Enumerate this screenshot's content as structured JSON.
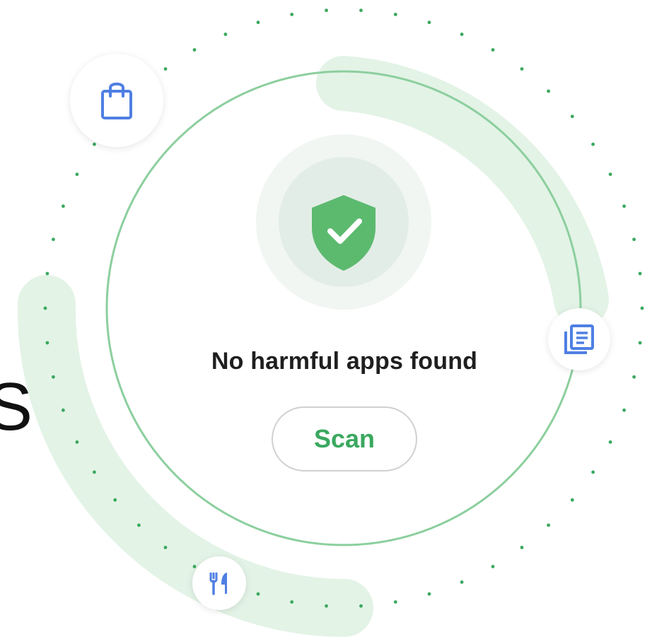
{
  "status": {
    "message": "No harmful apps found"
  },
  "scan_button": {
    "label": "Scan"
  },
  "partial_text": "S",
  "colors": {
    "accent_green": "#34a853",
    "ring_green": "#8ccf9e",
    "track_green": "#e3f3e6",
    "dot_green": "#3aa85f",
    "icon_blue": "#4f7fe3",
    "shield_green": "#5cba6f"
  },
  "icons": [
    "shopping-bag-icon",
    "document-list-icon",
    "restaurant-icon",
    "shield-check-icon"
  ]
}
